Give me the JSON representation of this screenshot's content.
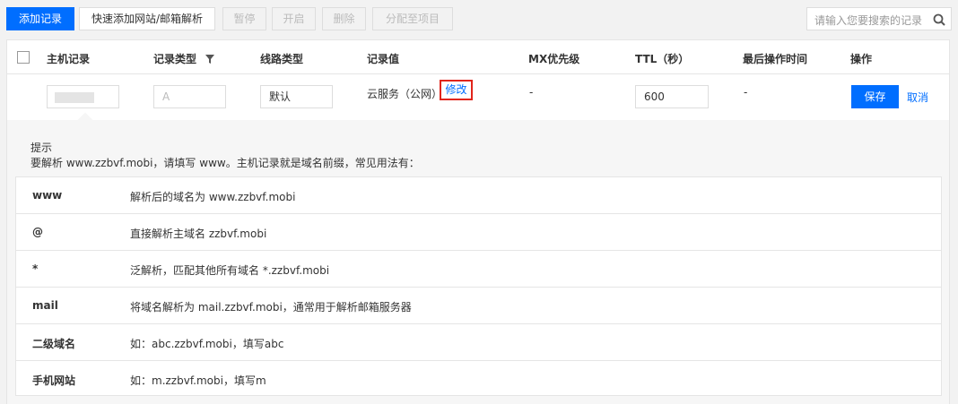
{
  "toolbar": {
    "add_record": "添加记录",
    "quick_add": "快速添加网站/邮箱解析",
    "pause": "暂停",
    "enable": "开启",
    "delete": "删除",
    "assign_project": "分配至项目",
    "search_placeholder": "请输入您要搜索的记录"
  },
  "table": {
    "headers": {
      "host": "主机记录",
      "type": "记录类型",
      "line": "线路类型",
      "value": "记录值",
      "mx": "MX优先级",
      "ttl": "TTL（秒）",
      "last_op": "最后操作时间",
      "action": "操作"
    },
    "edit_row": {
      "type_value": "A",
      "line_value": "默认",
      "record_value_text": "云服务（公网）",
      "modify_link": "修改",
      "mx_value": "-",
      "ttl_value": "600",
      "last_op_value": "-",
      "save": "保存",
      "cancel": "取消"
    }
  },
  "tip": {
    "title": "提示",
    "desc": "要解析 www.zzbvf.mobi，请填写 www。主机记录就是域名前缀，常见用法有：",
    "rows": [
      {
        "key": "www",
        "value": "解析后的域名为 www.zzbvf.mobi"
      },
      {
        "key": "@",
        "value": "直接解析主域名 zzbvf.mobi"
      },
      {
        "key": "*",
        "value": "泛解析，匹配其他所有域名 *.zzbvf.mobi"
      },
      {
        "key": "mail",
        "value": "将域名解析为 mail.zzbvf.mobi，通常用于解析邮箱服务器"
      },
      {
        "key": "二级域名",
        "value": "如：abc.zzbvf.mobi，填写abc"
      },
      {
        "key": "手机网站",
        "value": "如：m.zzbvf.mobi，填写m"
      }
    ]
  },
  "colors": {
    "primary": "#006eff",
    "highlight": "#e1251b"
  }
}
